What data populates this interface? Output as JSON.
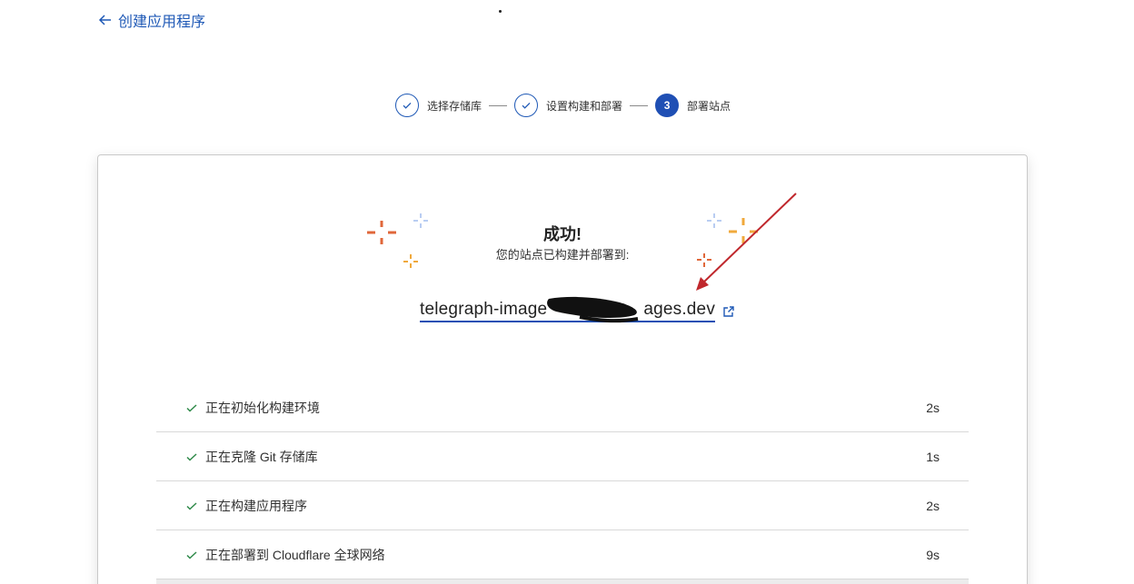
{
  "nav": {
    "back_label": "创建应用程序"
  },
  "stepper": {
    "steps": [
      {
        "label": "选择存储库",
        "state": "done"
      },
      {
        "label": "设置构建和部署",
        "state": "done"
      },
      {
        "label": "部署站点",
        "state": "active",
        "number": "3"
      }
    ]
  },
  "result": {
    "title": "成功!",
    "subtitle": "您的站点已构建并部署到:",
    "site_url": "telegraph-image",
    "site_url_end": "ages.dev"
  },
  "log": [
    {
      "label": "正在初始化构建环境",
      "time": "2s"
    },
    {
      "label": "正在克隆 Git 存储库",
      "time": "1s"
    },
    {
      "label": "正在构建应用程序",
      "time": "2s"
    },
    {
      "label": "正在部署到 Cloudflare 全球网络",
      "time": "9s"
    }
  ],
  "colors": {
    "accent": "#1f4fb4",
    "success": "#2f8a4a",
    "sparkle_orange": "#e0673a",
    "sparkle_yellow": "#f0a93c",
    "sparkle_blue": "#b9cdf2",
    "annotation_red": "#c0282d"
  }
}
